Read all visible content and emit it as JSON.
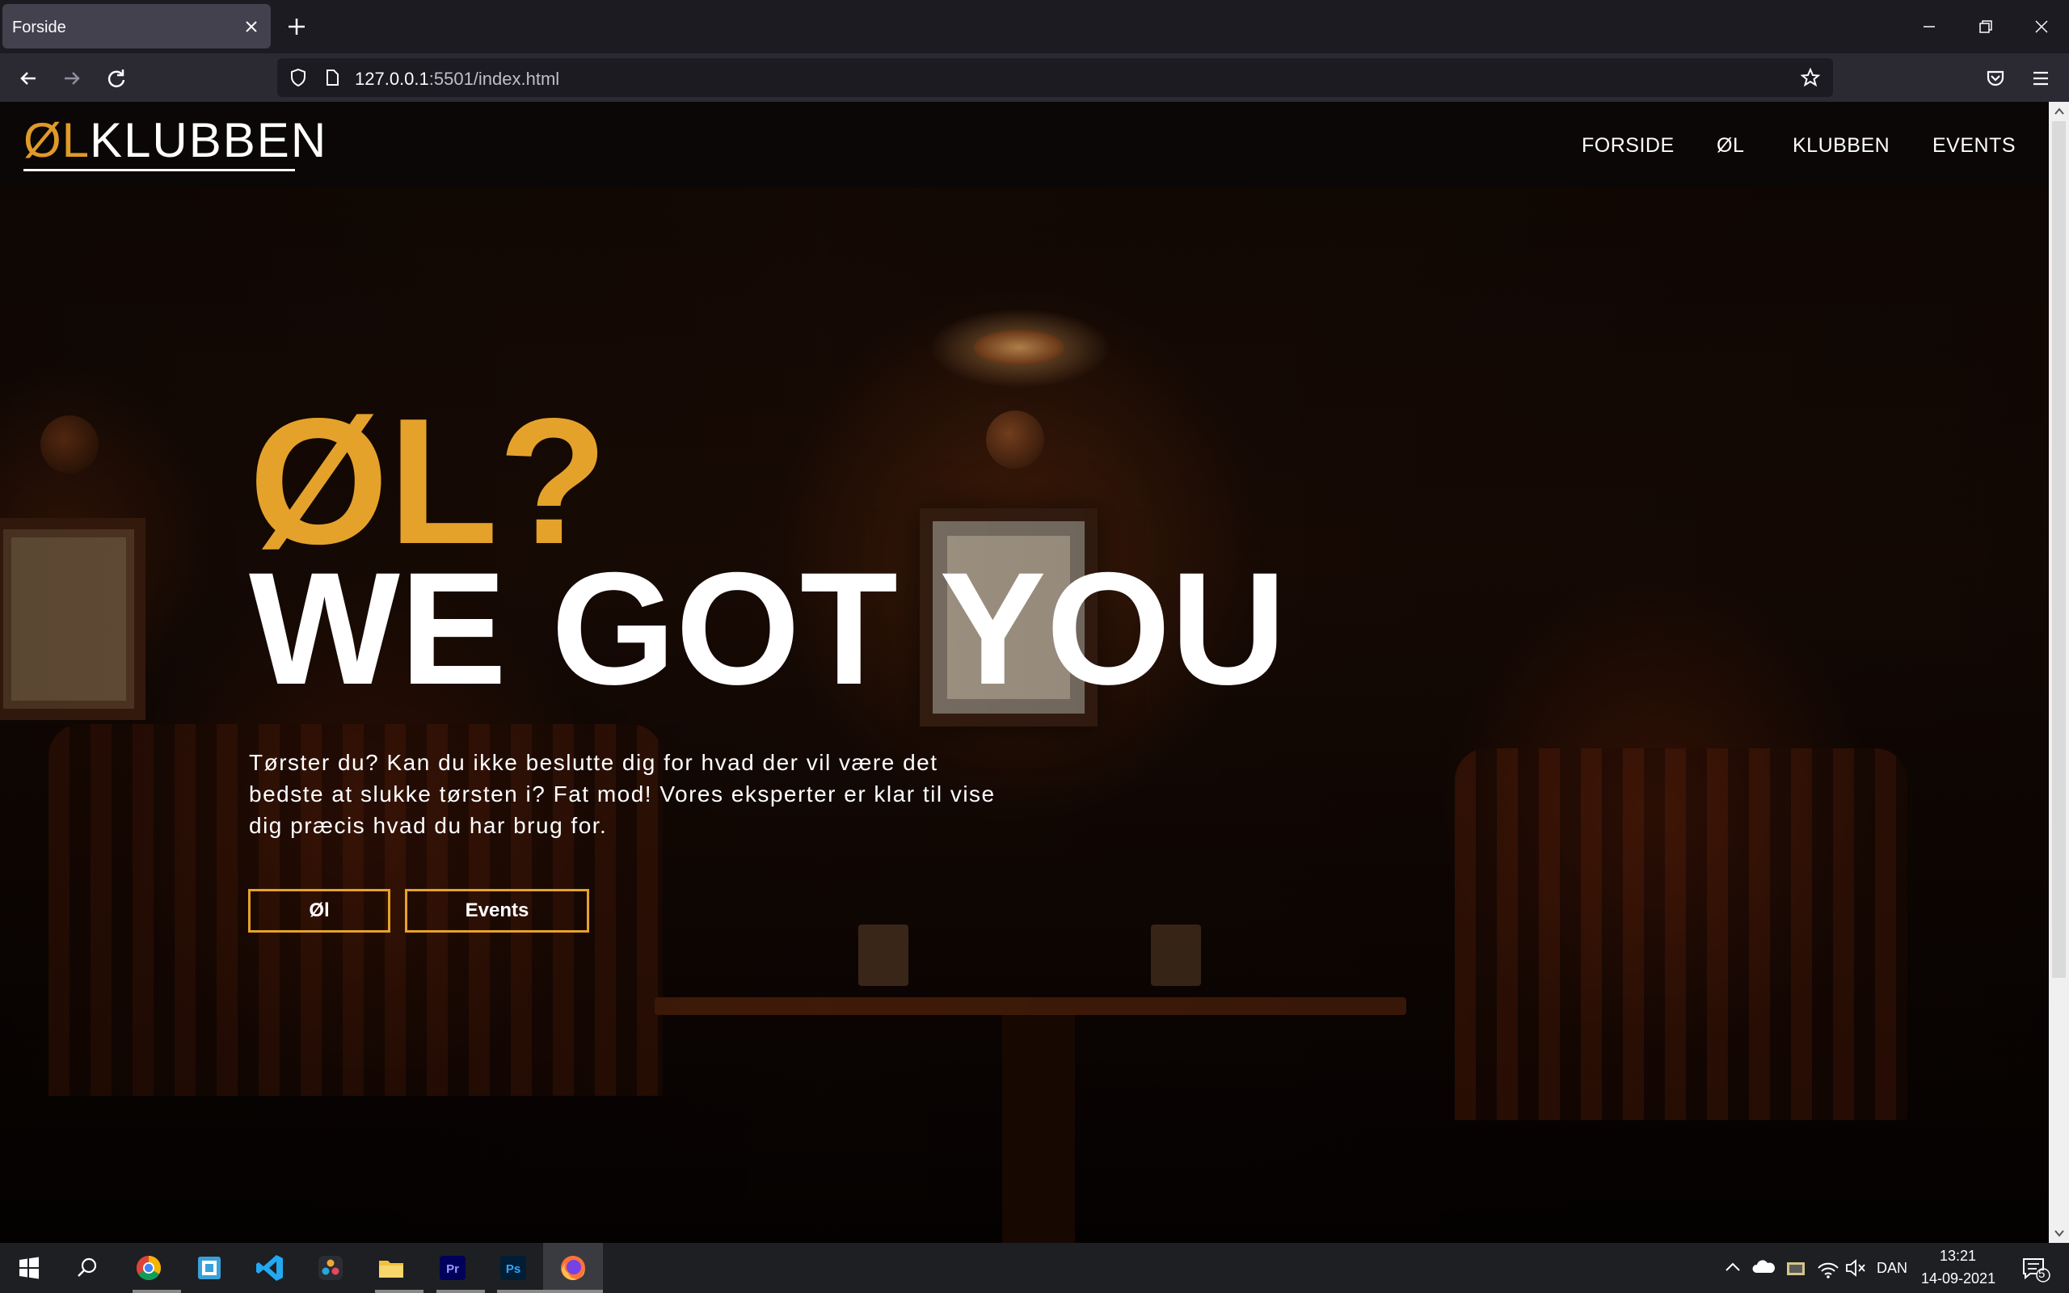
{
  "browser": {
    "tab_title": "Forside",
    "url_host": "127.0.0.1",
    "url_rest": ":5501/index.html"
  },
  "site": {
    "logo_part1": "ØL",
    "logo_part2": "KLUBBEN",
    "nav": [
      "FORSIDE",
      "ØL",
      "KLUBBEN",
      "EVENTS"
    ]
  },
  "hero": {
    "kicker": "ØL?",
    "title": "WE GOT YOU",
    "body": "Tørster du? Kan du ikke beslutte dig for hvad der vil være det bedste at slukke tørsten i? Fat mod! Vores eksperter er klar til vise dig præcis hvad du har brug for.",
    "button_beer": "Øl",
    "button_events": "Events"
  },
  "taskbar": {
    "apps": [
      "windows-start",
      "search",
      "chrome",
      "app-box",
      "vscode",
      "davinci-resolve",
      "file-explorer",
      "premiere-pro",
      "photoshop",
      "firefox"
    ],
    "language": "DAN",
    "time": "13:21",
    "date": "14-09-2021",
    "notification_count": "5"
  },
  "colors": {
    "accent": "#e5a22b",
    "browser_bg": "#1c1b22",
    "header_bg": "#0a0706"
  }
}
